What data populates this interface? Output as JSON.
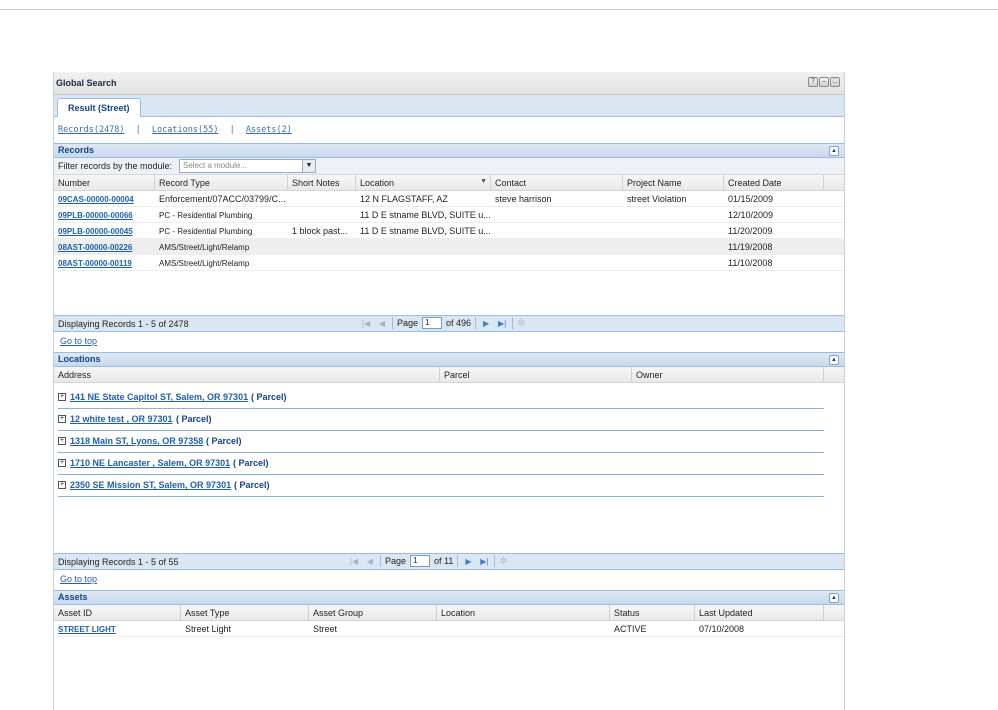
{
  "window": {
    "title": "Global Search",
    "tab_label": "Result (Street)"
  },
  "quick_links": {
    "records": "Records(2478)",
    "locations": "Locations(55)",
    "assets": "Assets(2)",
    "sep": "|"
  },
  "records": {
    "title": "Records",
    "filter_label": "Filter records by the module:",
    "filter_placeholder": "Select a module...",
    "columns": [
      "Number",
      "Record Type",
      "Short Notes",
      "Location",
      "Contact",
      "Project Name",
      "Created Date"
    ],
    "rows": [
      [
        "09CAS-00000-00004",
        "Enforcement/07ACC/03799/C...",
        "",
        "12 N FLAGSTAFF, AZ",
        "steve harrison",
        "street Violation",
        "01/15/2009"
      ],
      [
        "09PLB-00000-00066",
        "PC - Residential Plumbing",
        "",
        "11 D E stname BLVD, SUITE u...",
        "",
        "",
        "12/10/2009"
      ],
      [
        "09PLB-00000-00045",
        "PC - Residential Plumbing",
        "1 block past...",
        "11 D E stname BLVD, SUITE u...",
        "",
        "",
        "11/20/2009"
      ],
      [
        "08AST-00000-00226",
        "AMS/Street/Light/Relamp",
        "",
        "",
        "",
        "",
        "11/19/2008"
      ],
      [
        "08AST-00000-00119",
        "AMS/Street/Light/Relamp",
        "",
        "",
        "",
        "",
        "11/10/2008"
      ]
    ],
    "paging": {
      "display": "Displaying Records 1 - 5 of 2478",
      "page_label": "Page",
      "page_value": "1",
      "of_label": "of 496"
    },
    "go_to_top": "Go to top"
  },
  "locations": {
    "title": "Locations",
    "columns": [
      "Address",
      "Parcel",
      "Owner"
    ],
    "items": [
      {
        "address": "141 NE State Capitol ST, Salem, OR 97301",
        "tag": "( Parcel)"
      },
      {
        "address": "12 white test , OR 97301",
        "tag": "( Parcel)"
      },
      {
        "address": "1318 Main ST, Lyons, OR 97358",
        "tag": "( Parcel)"
      },
      {
        "address": "1710 NE Lancaster , Salem, OR 97301",
        "tag": "( Parcel)"
      },
      {
        "address": "2350 SE Mission ST, Salem, OR 97301",
        "tag": "( Parcel)"
      }
    ],
    "paging": {
      "display": "Displaying Records 1 - 5 of 55",
      "page_label": "Page",
      "page_value": "1",
      "of_label": "of 11"
    },
    "go_to_top": "Go to top"
  },
  "assets": {
    "title": "Assets",
    "columns": [
      "Asset ID",
      "Asset Type",
      "Asset Group",
      "Location",
      "Status",
      "Last Updated"
    ],
    "rows": [
      [
        "STREET LIGHT",
        "Street Light",
        "Street",
        "",
        "ACTIVE",
        "07/10/2008"
      ]
    ]
  },
  "icons": {
    "expand": "plus-box-icon",
    "collapse": "collapse-up-icon",
    "refresh": "refresh-icon"
  },
  "colors": {
    "link": "#1f5fb0",
    "section_header": "#c8d9ee",
    "accent_border": "#99bbe8"
  }
}
